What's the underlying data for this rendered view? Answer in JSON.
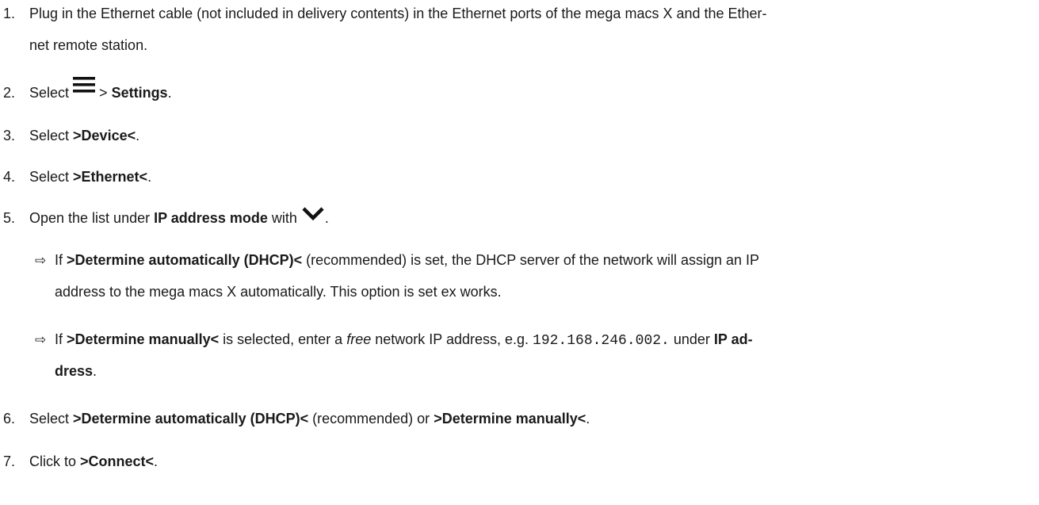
{
  "steps": [
    {
      "num": "1.",
      "line1": "Plug in the Ethernet cable (not included in delivery contents) in the Ethernet ports of the mega macs X and the Ether-",
      "line2": "net remote station."
    },
    {
      "num": "2.",
      "pre": "Select",
      "icon": "menu-icon",
      "mid": " > ",
      "bold": "Settings",
      "post": "."
    },
    {
      "num": "3.",
      "pre": "Select ",
      "bold": ">Device<",
      "post": "."
    },
    {
      "num": "4.",
      "pre": "Select ",
      "bold": ">Ethernet<",
      "post": "."
    },
    {
      "num": "5.",
      "pre": "Open the list under ",
      "bold": "IP address mode",
      "mid": " with",
      "icon": "chevron-down-icon",
      "post": "."
    },
    {
      "num": "6.",
      "pre": "Select ",
      "bold": ">Determine automatically (DHCP)<",
      "mid": " (recommended) or ",
      "bold2": ">Determine manually<",
      "post": "."
    },
    {
      "num": "7.",
      "pre": "Click to ",
      "bold": ">Connect<",
      "post": "."
    }
  ],
  "results": [
    {
      "arrow": "⇨",
      "pre": "If ",
      "bold": ">Determine automatically (DHCP)<",
      "line1_post": " (recommended) is set, the DHCP server of the network will assign an IP",
      "line2": "address to the mega macs X automatically. This option is set ex works."
    },
    {
      "arrow": "⇨",
      "pre": "If ",
      "bold": ">Determine manually<",
      "mid": " is selected, enter a ",
      "italic": "free",
      "mid2": " network IP address, e.g. ",
      "code": "192.168.246.002.",
      "mid3": " under ",
      "bold2": "IP ad-",
      "line2_bold": "dress",
      "line2_post": "."
    }
  ]
}
